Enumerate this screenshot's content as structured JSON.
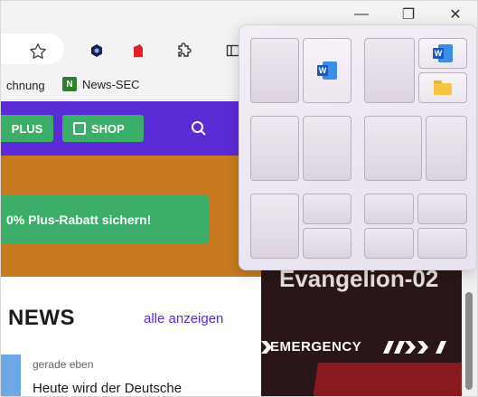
{
  "window": {
    "minimize_glyph": "—",
    "maximize_glyph": "❐",
    "close_glyph": "✕"
  },
  "bookmarks": {
    "items": [
      "chnung",
      "News-SEC"
    ],
    "favicon_letter": "N"
  },
  "site_nav": {
    "plus_label": "PLUS",
    "shop_label": "SHOP"
  },
  "banner": {
    "cta_label": "0% Plus-Rabatt sichern!"
  },
  "promo": {
    "title": "Evangelion-02",
    "emergency": "EMERGENCY"
  },
  "news": {
    "heading": "NEWS",
    "more_link": "alle anzeigen",
    "items": [
      {
        "time": "gerade eben",
        "headline": "Heute wird der Deutsche"
      }
    ]
  },
  "snap_layouts": {
    "word_letter": "W",
    "layouts": [
      {
        "name": "two-halves"
      },
      {
        "name": "wide-left-two-right"
      },
      {
        "name": "two-equal-columns"
      },
      {
        "name": "wide-left-narrow-right"
      },
      {
        "name": "left-half-right-stacked"
      },
      {
        "name": "quad-grid"
      }
    ]
  },
  "colors": {
    "site_purple": "#5b2bd6",
    "site_green": "#3cae6a",
    "banner_orange": "#c97a1e",
    "link": "#5b2bd6"
  }
}
